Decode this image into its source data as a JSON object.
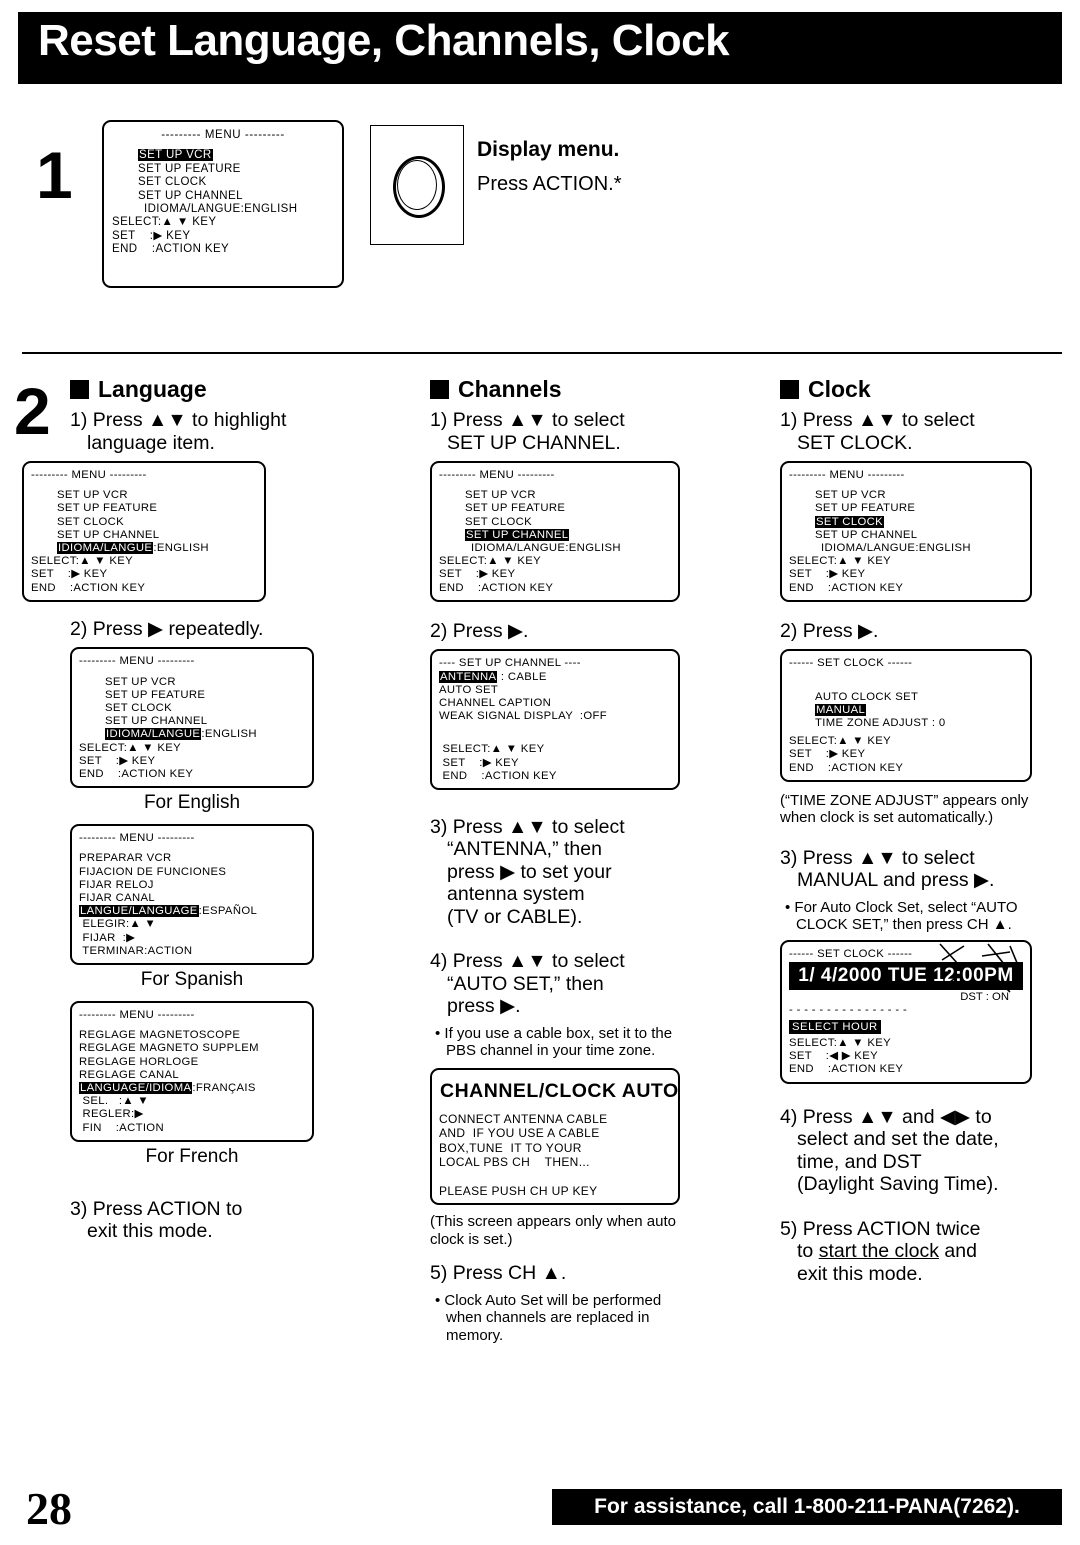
{
  "header": {
    "title": "Reset Language, Channels, Clock"
  },
  "step1": {
    "number": "1",
    "heading": "Display menu.",
    "body": "Press ACTION.*",
    "menu": {
      "header": "--------- MENU ---------",
      "items": [
        "SET UP VCR",
        "SET UP FEATURE",
        "SET CLOCK",
        "SET UP CHANNEL",
        "IDIOMA/LANGUE:ENGLISH"
      ],
      "highlight": "SET UP VCR",
      "keys": [
        "SELECT:▲ ▼ KEY",
        "SET    :▶ KEY",
        "END    :ACTION KEY"
      ]
    },
    "button_icon": "action-button-icon"
  },
  "step2_number": "2",
  "language": {
    "heading": "Language",
    "step1": {
      "label": "1)",
      "text": "Press ▲▼ to highlight",
      "text2": "language item."
    },
    "menu1": {
      "header": "--------- MENU ---------",
      "items": [
        "SET UP VCR",
        "SET UP FEATURE",
        "SET CLOCK",
        "SET UP CHANNEL"
      ],
      "highlight_label": "IDIOMA/LANGUE",
      "highlight_value": ":ENGLISH",
      "keys": [
        "SELECT:▲ ▼ KEY",
        "SET    :▶ KEY",
        "END    :ACTION KEY"
      ]
    },
    "step2": {
      "label": "2)",
      "text": "Press ▶ repeatedly."
    },
    "menu_english": {
      "header": "--------- MENU ---------",
      "items": [
        "SET UP VCR",
        "SET UP FEATURE",
        "SET CLOCK",
        "SET UP CHANNEL"
      ],
      "highlight_label": "IDIOMA/LANGUE",
      "highlight_value": ":ENGLISH",
      "keys": [
        "SELECT:▲ ▼ KEY",
        "SET    :▶ KEY",
        "END    :ACTION KEY"
      ],
      "caption": "For English"
    },
    "menu_spanish": {
      "header": "--------- MENU ---------",
      "items": [
        "PREPARAR VCR",
        "FIJACION DE FUNCIONES",
        "FIJAR RELOJ",
        "FIJAR CANAL"
      ],
      "highlight_label": "LANGUE/LANGUAGE",
      "highlight_value": ":ESPAÑOL",
      "keys": [
        " ELEGIR:▲ ▼",
        " FIJAR  :▶",
        " TERMINAR:ACTION"
      ],
      "caption": "For Spanish"
    },
    "menu_french": {
      "header": "--------- MENU ---------",
      "items": [
        "REGLAGE MAGNETOSCOPE",
        "REGLAGE MAGNETO SUPPLEM",
        "REGLAGE HORLOGE",
        "REGLAGE CANAL"
      ],
      "highlight_label": "LANGUAGE/IDIOMA",
      "highlight_value": ":FRANÇAIS",
      "keys": [
        " SEL.   :▲ ▼",
        " REGLER:▶",
        " FIN    :ACTION"
      ],
      "caption": "For French"
    },
    "step3": {
      "label": "3)",
      "text": "Press ACTION to",
      "text2": "exit this mode."
    }
  },
  "channels": {
    "heading": "Channels",
    "step1": {
      "label": "1)",
      "text": "Press ▲▼ to select",
      "text2": "SET UP CHANNEL."
    },
    "menu1": {
      "header": "--------- MENU ---------",
      "items": [
        "SET UP VCR",
        "SET UP FEATURE",
        "SET CLOCK",
        "SET UP CHANNEL",
        "IDIOMA/LANGUE:ENGLISH"
      ],
      "highlight": "SET UP CHANNEL",
      "keys": [
        "SELECT:▲ ▼ KEY",
        "SET    :▶ KEY",
        "END    :ACTION KEY"
      ]
    },
    "step2": {
      "label": "2)",
      "text": "Press ▶."
    },
    "menu2": {
      "header": "---- SET UP CHANNEL ----",
      "highlight": "ANTENNA",
      "highlight_value": " : CABLE",
      "items": [
        "AUTO SET",
        "CHANNEL CAPTION",
        "WEAK SIGNAL DISPLAY  :OFF"
      ],
      "keys": [
        " SELECT:▲ ▼ KEY",
        " SET    :▶ KEY",
        " END    :ACTION KEY"
      ]
    },
    "step3": {
      "label": "3)",
      "lines": [
        "Press ▲▼ to select",
        "“ANTENNA,” then",
        "press ▶ to set your",
        "antenna system",
        "(TV or CABLE)."
      ]
    },
    "step4": {
      "label": "4)",
      "lines": [
        "Press ▲▼ to select",
        "“AUTO SET,” then",
        "press ▶."
      ]
    },
    "step4_note": "If you use a cable box, set it to the PBS channel in your time zone.",
    "autoset_screen": {
      "title": "CHANNEL/CLOCK AUTO SET",
      "lines": [
        "CONNECT ANTENNA CABLE",
        "AND  IF YOU USE A CABLE",
        "BOX,TUNE  IT TO YOUR",
        "LOCAL PBS CH    THEN..."
      ],
      "prompt": "PLEASE PUSH CH UP KEY"
    },
    "autoset_caption": "(This screen appears only when auto clock is set.)",
    "step5": {
      "label": "5)",
      "text": "Press CH ▲."
    },
    "step5_note": "Clock Auto Set will be performed when channels are replaced in memory."
  },
  "clock": {
    "heading": "Clock",
    "step1": {
      "label": "1)",
      "text": "Press ▲▼ to select",
      "text2": "SET CLOCK."
    },
    "menu1": {
      "header": "--------- MENU ---------",
      "items": [
        "SET UP VCR",
        "SET UP FEATURE",
        "SET CLOCK",
        "SET UP CHANNEL",
        "IDIOMA/LANGUE:ENGLISH"
      ],
      "highlight": "SET CLOCK",
      "keys": [
        "SELECT:▲ ▼ KEY",
        "SET    :▶ KEY",
        "END    :ACTION KEY"
      ]
    },
    "step2": {
      "label": "2)",
      "text": "Press ▶."
    },
    "menu2": {
      "header": "------ SET CLOCK ------",
      "items": [
        "AUTO CLOCK SET"
      ],
      "highlight": "MANUAL",
      "item_after": "TIME ZONE ADJUST : 0",
      "keys": [
        "SELECT:▲ ▼ KEY",
        "SET    :▶ KEY",
        "END    :ACTION KEY"
      ]
    },
    "tz_note": "(“TIME ZONE ADJUST” appears only when clock is set automatically.)",
    "step3": {
      "label": "3)",
      "text": "Press ▲▼ to select",
      "text2": "MANUAL and press ▶."
    },
    "step3_note": "For Auto Clock Set, select “AUTO CLOCK SET,” then press CH ▲.",
    "clock_screen": {
      "header": "------ SET CLOCK ------",
      "datetime": "1/ 4/2000 TUE 12:00PM",
      "dst": "DST : ON",
      "divider": "- - - - - - - - - - - - - - - -",
      "select_hour": "SELECT HOUR",
      "keys": [
        "SELECT:▲ ▼ KEY",
        "SET    :◀ ▶ KEY",
        "END    :ACTION KEY"
      ]
    },
    "step4": {
      "label": "4)",
      "lines": [
        "Press ▲▼ and ◀▶ to",
        "select and set the date,",
        "time, and DST",
        "(Daylight Saving Time)."
      ]
    },
    "step5": {
      "label": "5)",
      "line1": "Press ACTION twice",
      "line2_pre": "to ",
      "line2_u": "start the clock",
      "line2_post": " and",
      "line3": "exit this mode."
    }
  },
  "footer": {
    "page_number": "28",
    "assistance": "For assistance, call 1-800-211-PANA(7262)."
  }
}
